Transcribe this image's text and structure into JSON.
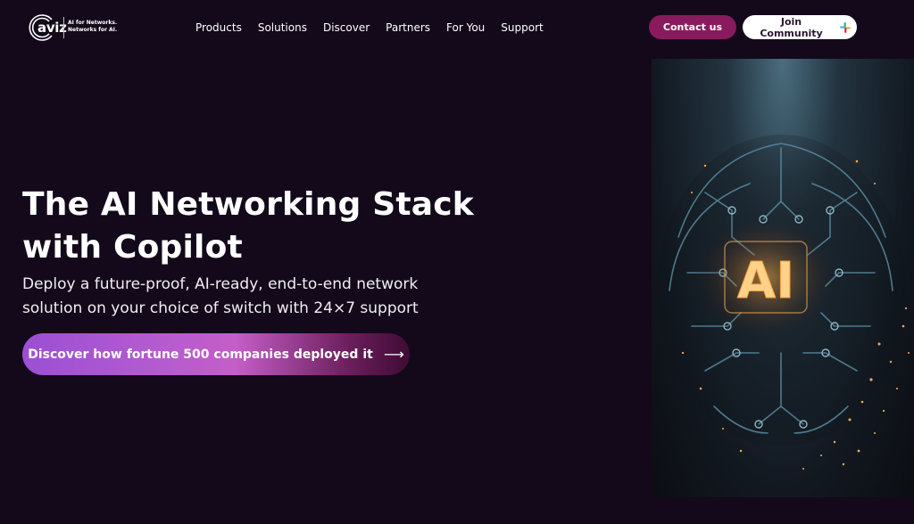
{
  "header": {
    "logo": {
      "wordmark": "aviz",
      "tagline_line1": "AI for Networks.",
      "tagline_line2": "Networks for AI."
    },
    "nav": [
      {
        "label": "Products"
      },
      {
        "label": "Solutions"
      },
      {
        "label": "Discover"
      },
      {
        "label": "Partners"
      },
      {
        "label": "For You"
      },
      {
        "label": "Support"
      }
    ],
    "contact_label": "Contact us",
    "join_label": "Join Community",
    "join_icon": "slack-icon"
  },
  "hero": {
    "title_line1": "The AI Networking Stack",
    "title_line2": "with Copilot",
    "subtitle_line1": "Deploy a future-proof, AI-ready, end-to-end network",
    "subtitle_line2": "solution on your choice of switch with 24×7 support",
    "cta_label": "Discover how fortune 500 companies deployed it",
    "cta_icon": "arrow-right-icon",
    "image_text": "AI"
  },
  "colors": {
    "background": "#13091a",
    "contact_button": "#8a1a5e",
    "cta_gradient_start": "#9b4fd4",
    "cta_gradient_end": "#3e0c34"
  }
}
